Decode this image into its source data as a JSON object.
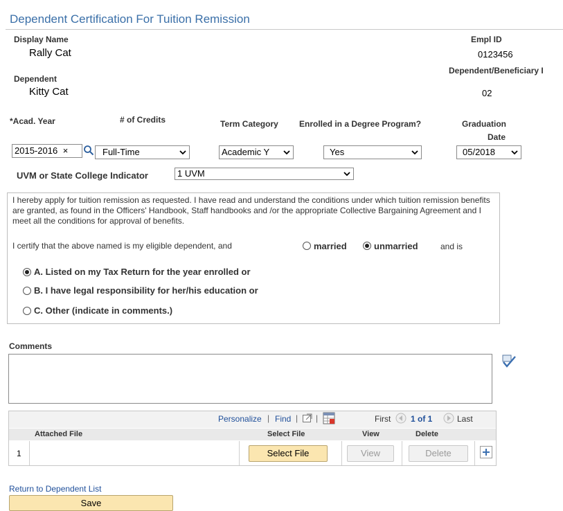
{
  "page": {
    "title": "Dependent Certification For Tuition Remission"
  },
  "employee": {
    "display_name_label": "Display Name",
    "display_name": "Rally Cat",
    "empl_id_label": "Empl ID",
    "empl_id": "0123456",
    "dependent_label": "Dependent",
    "dependent_name": "Kitty Cat",
    "dep_ben_label": "Dependent/Beneficiary I",
    "dep_ben_id": "02"
  },
  "enrollment": {
    "headers": {
      "acad_year": "*Acad. Year",
      "credits": "# of Credits",
      "term_category": "Term Category",
      "degree_program": "Enrolled in a Degree Program?",
      "graduation_line1": "Graduation",
      "graduation_line2": "Date"
    },
    "acad_year": "2015-2016",
    "acad_year_clear": "×",
    "credits": "Full-Time",
    "term_category": "Academic Y",
    "degree_program": "Yes",
    "graduation_date": "05/2018",
    "college_indicator_label": "UVM or State College Indicator",
    "college_indicator": "1 UVM"
  },
  "certification": {
    "paragraph": "I hereby apply for tuition remission as requested. I have read and understand the conditions under which tuition remission benefits are granted, as found in the Officers' Handbook, Staff handbooks and /or the appropriate Collective Bargaining Agreement and I meet all the conditions for approval of benefits.",
    "certify_text": "I certify that the above named is my eligible dependent, and",
    "married_label": "married",
    "unmarried_label": "unmarried",
    "and_is": "and is",
    "selected_status": "unmarried",
    "options": [
      {
        "label": "A. Listed on my Tax Return for the year enrolled or",
        "selected": true
      },
      {
        "label": "B. I have legal responsibility for her/his education or",
        "selected": false
      },
      {
        "label": "C. Other (indicate in comments.)",
        "selected": false
      }
    ]
  },
  "comments": {
    "label": "Comments",
    "value": ""
  },
  "attachments": {
    "toolbar": {
      "personalize": "Personalize",
      "sep": "|",
      "find": "Find",
      "first": "First",
      "range": "1 of 1",
      "last": "Last"
    },
    "columns": {
      "attached_file": "Attached File",
      "select_file": "Select File",
      "view": "View",
      "delete": "Delete"
    },
    "rows": [
      {
        "num": "1",
        "file": "",
        "select_btn": "Select File",
        "view_btn": "View",
        "delete_btn": "Delete"
      }
    ]
  },
  "footer": {
    "return_link": "Return to Dependent List",
    "save_btn": "Save"
  },
  "colors": {
    "title": "#3a6fa8",
    "link": "#1f4f9a",
    "button": "#fbe6b0"
  }
}
